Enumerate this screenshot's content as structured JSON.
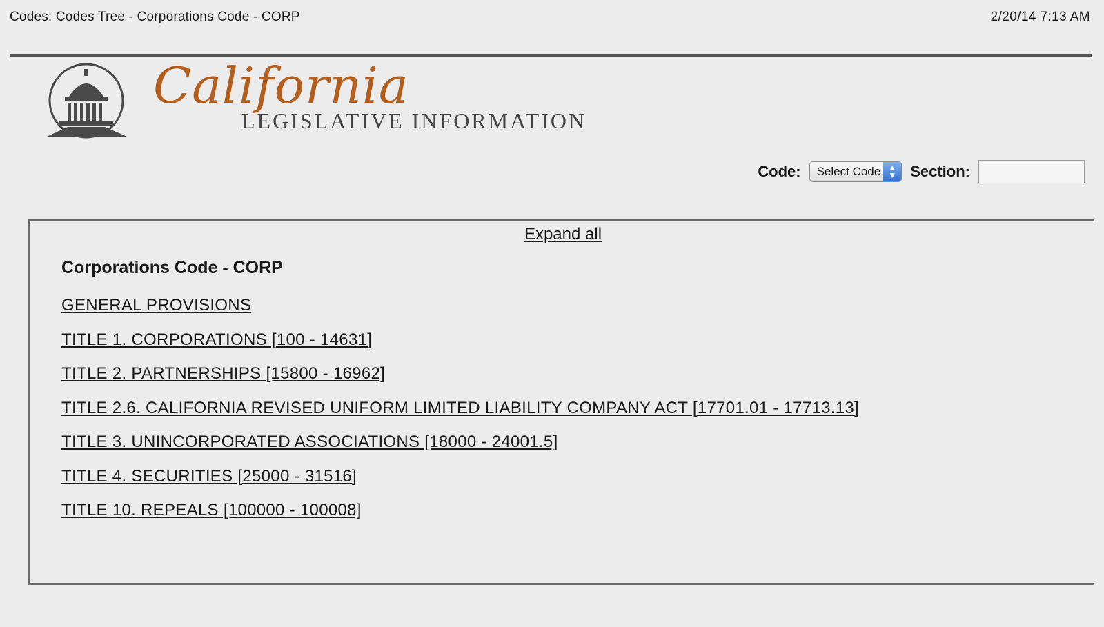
{
  "print_header": {
    "title": "Codes: Codes Tree - Corporations Code - CORP",
    "datetime": "2/20/14 7:13 AM"
  },
  "brand": {
    "script": "California",
    "subtitle": "LEGISLATIVE INFORMATION",
    "script_color": "#b35e1c"
  },
  "search": {
    "code_label": "Code:",
    "code_select_value": "Select Code",
    "section_label": "Section:",
    "section_value": ""
  },
  "tree": {
    "expand_all": "Expand all",
    "code_title": "Corporations Code - CORP",
    "items": [
      "GENERAL PROVISIONS",
      "TITLE 1. CORPORATIONS [100 - 14631]",
      "TITLE 2. PARTNERSHIPS [15800 - 16962]",
      "TITLE 2.6. CALIFORNIA REVISED UNIFORM LIMITED LIABILITY COMPANY ACT [17701.01 - 17713.13]",
      "TITLE 3. UNINCORPORATED ASSOCIATIONS [18000 - 24001.5]",
      "TITLE 4. SECURITIES [25000 - 31516]",
      "TITLE 10. REPEALS [100000 - 100008]"
    ]
  }
}
